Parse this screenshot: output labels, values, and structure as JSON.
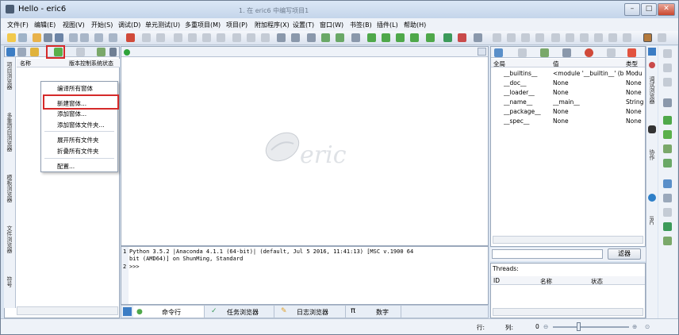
{
  "window": {
    "title": "Hello - eric6",
    "ghost_title": "1. 在 eric6 中编写项目1",
    "min": "–",
    "max": "□",
    "close": "✕"
  },
  "menubar": [
    "文件(F)",
    "编辑(E)",
    "视图(V)",
    "开始(S)",
    "调试(D)",
    "单元测试(U)",
    "多重项目(M)",
    "项目(P)",
    "附加程序(X)",
    "设置(T)",
    "窗口(W)",
    "书签(B)",
    "插件(L)",
    "帮助(H)"
  ],
  "project_panel": {
    "col_name": "名称",
    "col_vcs": "版本控制系统状态",
    "side_tabs": [
      "项目浏览器",
      "多重项目浏览器",
      "模板浏览器",
      "文件浏览器",
      "符号"
    ]
  },
  "context_menu": {
    "items": [
      "编译所有窗体",
      "新建窗体...",
      "添加窗体...",
      "添加窗体文件夹...",
      "展开所有文件夹",
      "折叠所有文件夹",
      "配置..."
    ]
  },
  "editor": {
    "logo_text": "eric"
  },
  "shell": {
    "lines": [
      "Python 3.5.2 |Anaconda 4.1.1 (64-bit)| (default, Jul  5 2016, 11:41:13) [MSC v.1900 64",
      "bit (AMD64)] on ShunMing, Standard",
      ">>>"
    ],
    "gutter": [
      "1",
      "",
      "2"
    ]
  },
  "bottom_tabs": [
    "命令行",
    "任务浏览器",
    "日志浏览器",
    "数字"
  ],
  "variables": {
    "headers": [
      "全局",
      "值",
      "类型"
    ],
    "rows": [
      [
        "__builtins__",
        "<module '__builtin__' (b...",
        "Modu"
      ],
      [
        "__doc__",
        "None",
        "None"
      ],
      [
        "__loader__",
        "None",
        "None"
      ],
      [
        "__name__",
        "__main__",
        "String"
      ],
      [
        "__package__",
        "None",
        "None"
      ],
      [
        "__spec__",
        "None",
        "None"
      ]
    ],
    "filter_button": "滤器"
  },
  "threads": {
    "label": "Threads:",
    "headers": [
      "ID",
      "名称",
      "状态"
    ]
  },
  "right_side_tabs": [
    "调试浏览器",
    "协作",
    "IRC"
  ],
  "status": {
    "line": "行:",
    "col": "列:",
    "zoom": "0"
  }
}
